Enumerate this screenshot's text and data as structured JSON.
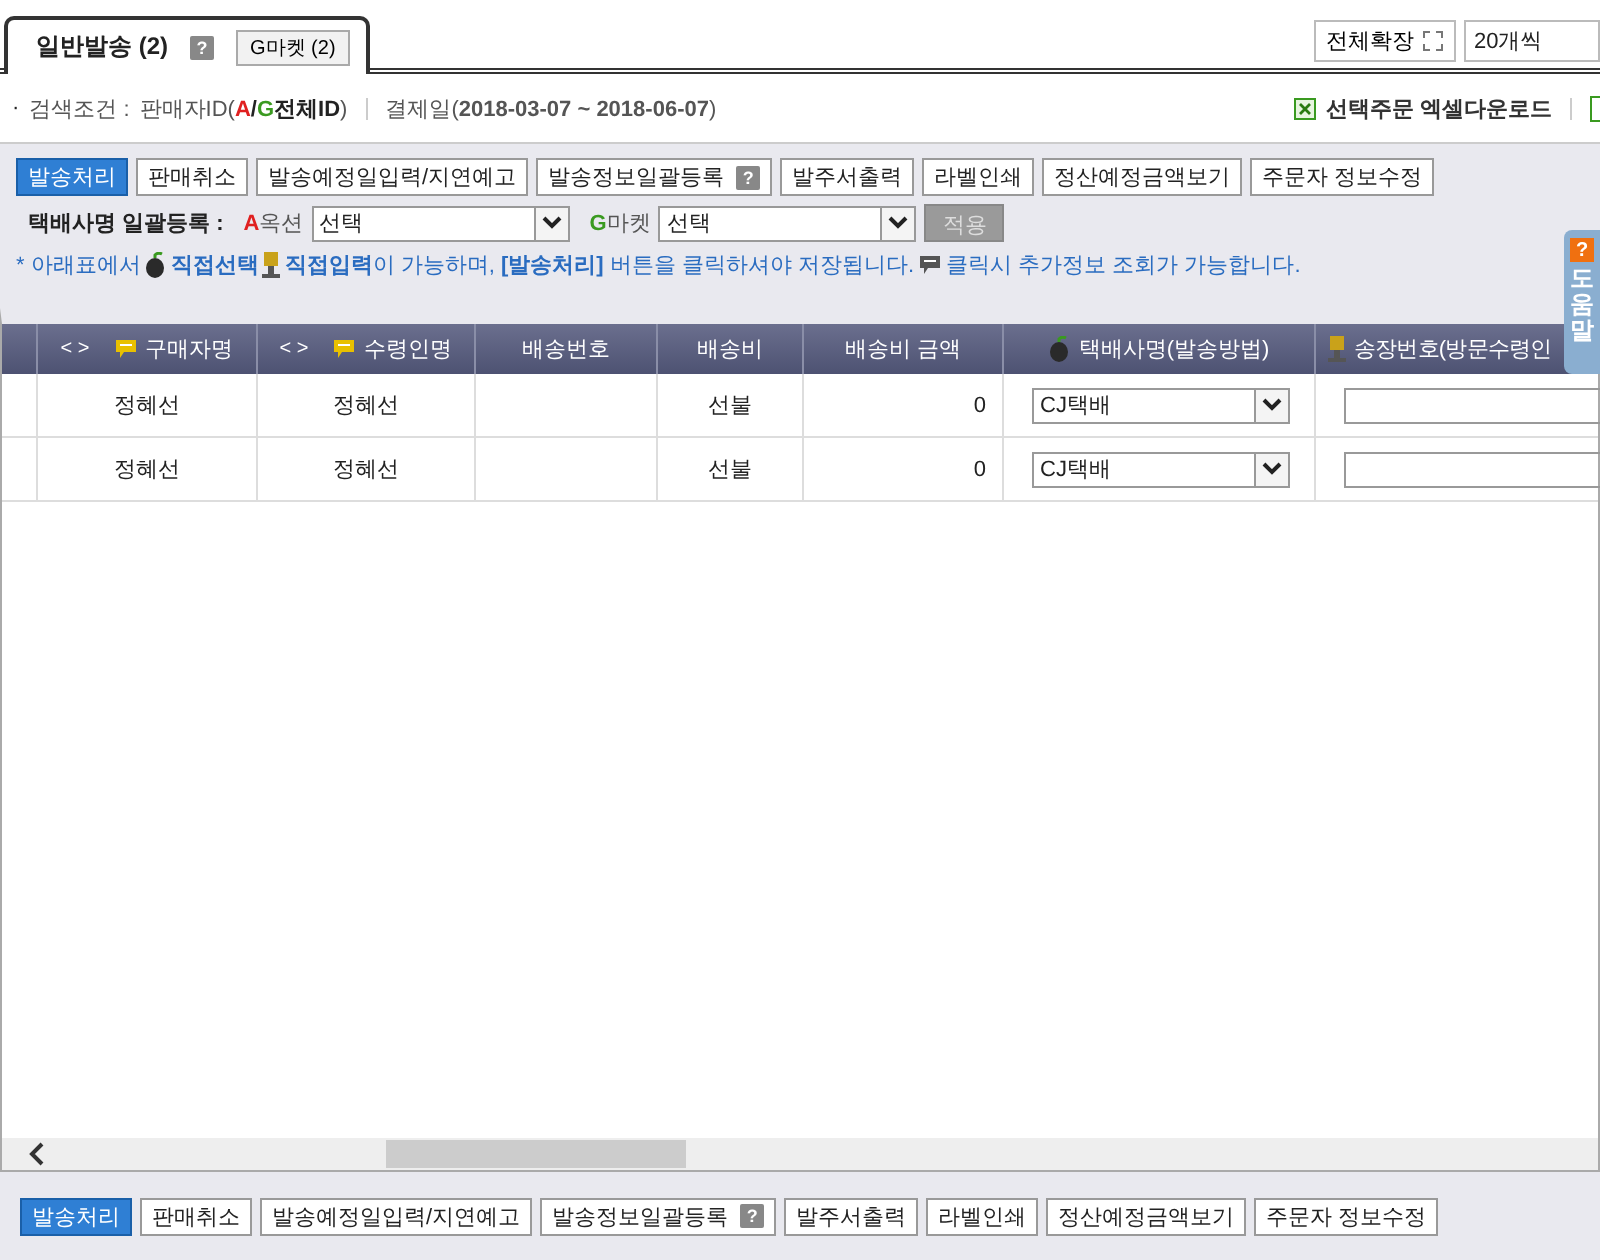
{
  "tabs": [
    {
      "label": "일반발송 (2)",
      "selected": true,
      "help": "?",
      "sub_button": "G마켓 (2)"
    }
  ],
  "expand_button": "전체확장",
  "page_size": "20개씩",
  "search": {
    "bullet": "·",
    "label": "검색조건 :",
    "seller_parts": [
      {
        "text": "판매자ID(",
        "kind": "plain"
      },
      {
        "text": "A",
        "kind": "red"
      },
      {
        "text": "/",
        "kind": "bold"
      },
      {
        "text": "G",
        "kind": "green"
      },
      {
        "text": "전체ID",
        "kind": "bold"
      },
      {
        "text": ")",
        "kind": "plain"
      }
    ],
    "date": "결제일(**2018-03-07 ~ 2018-06-07**)"
  },
  "excel_download": "선택주문 엑셀다운로드",
  "actions": [
    {
      "label": "발송처리",
      "kind": "primary"
    },
    {
      "label": "판매취소",
      "kind": "normal"
    },
    {
      "label": "발송예정일입력/지연예고",
      "kind": "normal"
    },
    {
      "label": "발송정보일괄등록",
      "kind": "normal",
      "help": "?"
    },
    {
      "label": "발주서출력",
      "kind": "normal"
    },
    {
      "label": "라벨인쇄",
      "kind": "normal"
    },
    {
      "label": "정산예정금액보기",
      "kind": "normal"
    },
    {
      "label": "주문자 정보수정",
      "kind": "normal"
    }
  ],
  "courier_bulk": {
    "label": "택배사명 일괄등록 :",
    "markets": [
      {
        "mark": "A",
        "name": "옥션",
        "color": "#e02020",
        "value": "선택"
      },
      {
        "mark": "G",
        "name": "마켓",
        "color": "#3a9a20",
        "value": "선택"
      }
    ],
    "apply": "적용",
    "apply_disabled": true
  },
  "info": [
    {
      "kind": "text",
      "text": "* 아래표에서"
    },
    {
      "kind": "mouse"
    },
    {
      "kind": "text",
      "text": "**직접선택**"
    },
    {
      "kind": "pen"
    },
    {
      "kind": "text",
      "text": "**직접입력**이 가능하며, **[발송처리]** 버튼을 클릭하셔야 저장됩니다."
    },
    {
      "kind": "comment"
    },
    {
      "kind": "text",
      "text": "클릭시 추가정보 조회가 가능합니다."
    }
  ],
  "help_tab": {
    "icon": "?",
    "label": "도움말"
  },
  "table": {
    "columns": [
      {
        "label": "구매자명",
        "arrows": "< >",
        "kind": "comment"
      },
      {
        "label": "수령인명",
        "arrows": "< >",
        "kind": "comment"
      },
      {
        "label": "배송번호",
        "kind": "plain"
      },
      {
        "label": "배송비",
        "kind": "plain"
      },
      {
        "label": "배송비 금액",
        "kind": "plain"
      },
      {
        "label": "택배사명(발송방법)",
        "kind": "mouse"
      },
      {
        "label": "송장번호(방문수령인",
        "kind": "pen"
      }
    ],
    "rows": [
      {
        "buyer": "정혜선",
        "receiver": "정혜선",
        "fee": "선불",
        "amount": "0",
        "courier": "CJ택배"
      },
      {
        "buyer": "정혜선",
        "receiver": "정혜선",
        "fee": "선불",
        "amount": "0",
        "courier": "CJ택배"
      }
    ]
  },
  "bottom_actions": [
    {
      "label": "발송처리",
      "kind": "primary"
    },
    {
      "label": "판매취소",
      "kind": "normal"
    },
    {
      "label": "발송예정일입력/지연예고",
      "kind": "normal"
    },
    {
      "label": "발송정보일괄등록",
      "kind": "normal",
      "help": "?"
    },
    {
      "label": "발주서출력",
      "kind": "normal"
    },
    {
      "label": "라벨인쇄",
      "kind": "normal"
    },
    {
      "label": "정산예정금액보기",
      "kind": "normal"
    },
    {
      "label": "주문자 정보수정",
      "kind": "normal"
    }
  ]
}
